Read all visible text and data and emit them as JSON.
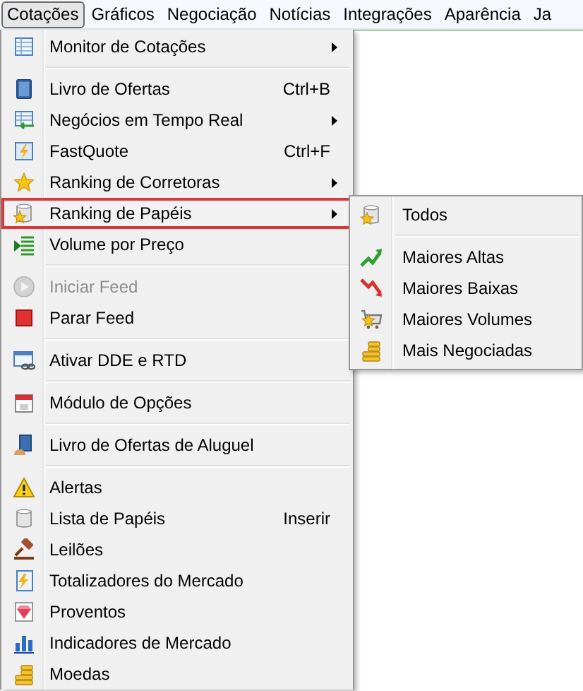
{
  "menubar": {
    "items": [
      {
        "label": "Cotações",
        "selected": true
      },
      {
        "label": "Gráficos",
        "selected": false
      },
      {
        "label": "Negociação",
        "selected": false
      },
      {
        "label": "Notícias",
        "selected": false
      },
      {
        "label": "Integrações",
        "selected": false
      },
      {
        "label": "Aparência",
        "selected": false
      },
      {
        "label": "Ja",
        "selected": false
      }
    ]
  },
  "menu": {
    "items": [
      {
        "kind": "item",
        "label": "Monitor de Cotações",
        "submenu": true,
        "disabled": false,
        "selected": false
      },
      {
        "kind": "separator"
      },
      {
        "kind": "item",
        "label": "Livro de Ofertas",
        "shortcut": "Ctrl+B",
        "submenu": false,
        "disabled": false,
        "selected": false
      },
      {
        "kind": "item",
        "label": "Negócios em Tempo Real",
        "submenu": true,
        "disabled": false,
        "selected": false
      },
      {
        "kind": "item",
        "label": "FastQuote",
        "shortcut": "Ctrl+F",
        "submenu": false,
        "disabled": false,
        "selected": false
      },
      {
        "kind": "item",
        "label": "Ranking de Corretoras",
        "submenu": true,
        "disabled": false,
        "selected": false
      },
      {
        "kind": "item",
        "label": "Ranking de Papéis",
        "submenu": true,
        "disabled": false,
        "selected": true
      },
      {
        "kind": "item",
        "label": "Volume por Preço",
        "submenu": false,
        "disabled": false,
        "selected": false
      },
      {
        "kind": "separator"
      },
      {
        "kind": "item",
        "label": "Iniciar Feed",
        "submenu": false,
        "disabled": true,
        "selected": false
      },
      {
        "kind": "item",
        "label": "Parar Feed",
        "submenu": false,
        "disabled": false,
        "selected": false
      },
      {
        "kind": "separator"
      },
      {
        "kind": "item",
        "label": "Ativar DDE e RTD",
        "submenu": false,
        "disabled": false,
        "selected": false
      },
      {
        "kind": "separator"
      },
      {
        "kind": "item",
        "label": "Módulo de Opções",
        "submenu": false,
        "disabled": false,
        "selected": false
      },
      {
        "kind": "separator"
      },
      {
        "kind": "item",
        "label": "Livro de Ofertas de Aluguel",
        "submenu": false,
        "disabled": false,
        "selected": false
      },
      {
        "kind": "separator"
      },
      {
        "kind": "item",
        "label": "Alertas",
        "submenu": false,
        "disabled": false,
        "selected": false
      },
      {
        "kind": "item",
        "label": "Lista de Papéis",
        "shortcut": "Inserir",
        "submenu": false,
        "disabled": false,
        "selected": false
      },
      {
        "kind": "item",
        "label": "Leilões",
        "submenu": false,
        "disabled": false,
        "selected": false
      },
      {
        "kind": "item",
        "label": "Totalizadores do Mercado",
        "submenu": false,
        "disabled": false,
        "selected": false
      },
      {
        "kind": "item",
        "label": "Proventos",
        "submenu": false,
        "disabled": false,
        "selected": false
      },
      {
        "kind": "item",
        "label": "Indicadores de Mercado",
        "submenu": false,
        "disabled": false,
        "selected": false
      },
      {
        "kind": "item",
        "label": "Moedas",
        "submenu": false,
        "disabled": false,
        "selected": false
      }
    ]
  },
  "submenu": {
    "items": [
      {
        "kind": "item",
        "label": "Todos"
      },
      {
        "kind": "separator"
      },
      {
        "kind": "item",
        "label": "Maiores Altas"
      },
      {
        "kind": "item",
        "label": "Maiores Baixas"
      },
      {
        "kind": "item",
        "label": "Maiores Volumes"
      },
      {
        "kind": "item",
        "label": "Mais Negociadas"
      }
    ]
  }
}
